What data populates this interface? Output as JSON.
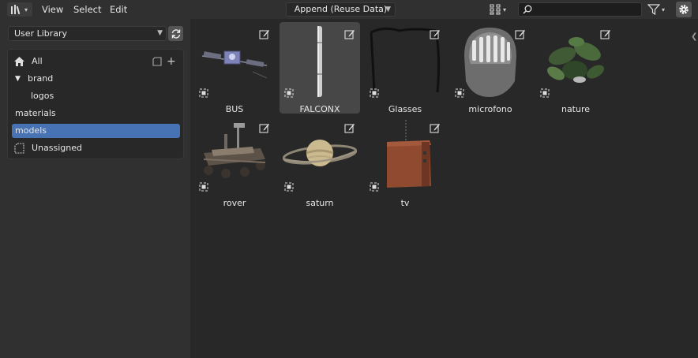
{
  "header": {
    "editor_type_icon": "file-browser-icon",
    "menus": [
      "View",
      "Select",
      "Edit"
    ],
    "import_method": "Append (Reuse Data)",
    "display_mode_icon": "thumbnails-grid-icon",
    "search": {
      "value": "",
      "placeholder": ""
    },
    "filter_icon": "funnel-icon",
    "settings_icon": "gear-icon"
  },
  "sidebar": {
    "library": "User Library",
    "catalogs": [
      {
        "label": "All",
        "icon": "home-icon"
      },
      {
        "label": "brand",
        "icon": "disclosure-triangle-down-icon"
      },
      {
        "label": "logos",
        "icon": ""
      },
      {
        "label": "materials",
        "icon": ""
      },
      {
        "label": "models",
        "icon": "",
        "selected": true
      },
      {
        "label": "Unassigned",
        "icon": "unassigned-catalog-icon"
      }
    ]
  },
  "assets": [
    {
      "label": "BUS",
      "preview": "satellite-bus"
    },
    {
      "label": "FALCONX",
      "preview": "rocket",
      "active": true
    },
    {
      "label": "Glasses",
      "preview": "glasses"
    },
    {
      "label": "microfono",
      "preview": "microphone"
    },
    {
      "label": "nature",
      "preview": "plant"
    },
    {
      "label": "rover",
      "preview": "rover"
    },
    {
      "label": "saturn",
      "preview": "saturn"
    },
    {
      "label": "tv",
      "preview": "tv"
    }
  ],
  "colors": {
    "accent": "#4772b3",
    "header": "#303030",
    "main_bg": "#282828",
    "active_tile": "#474747"
  }
}
